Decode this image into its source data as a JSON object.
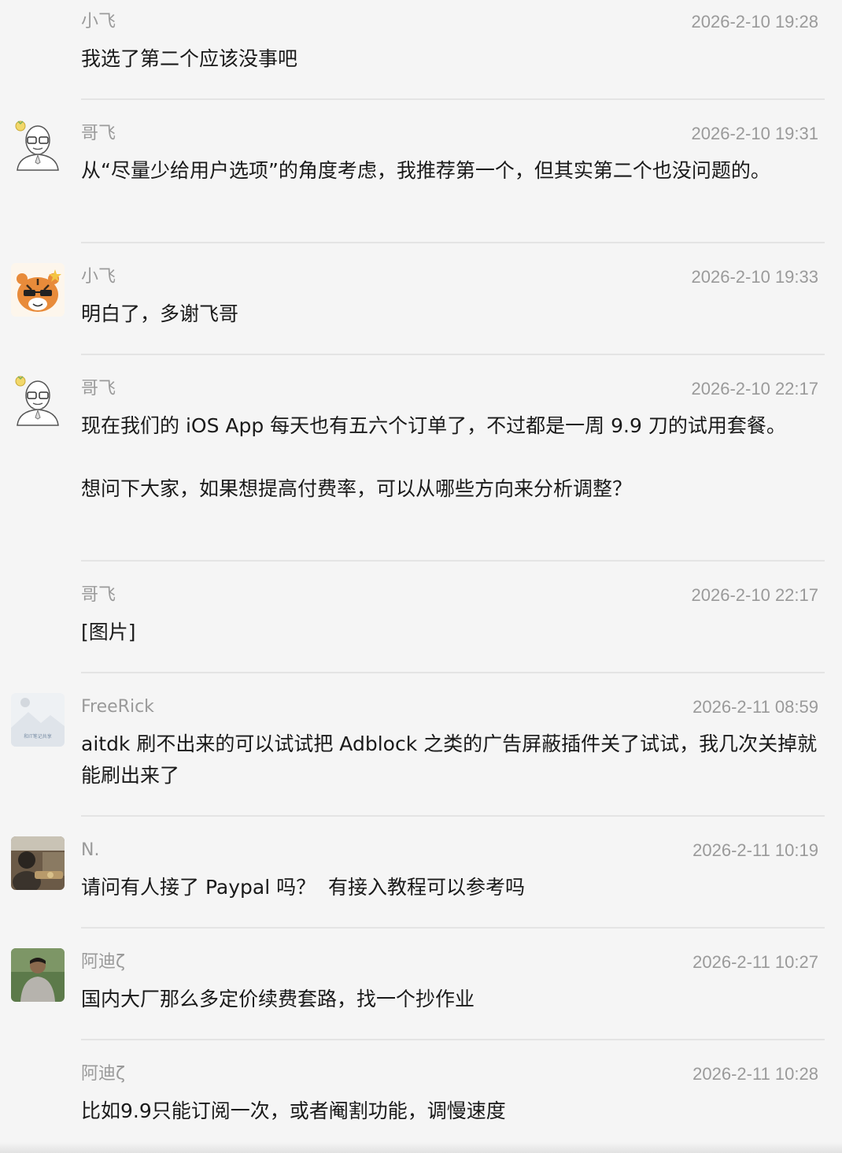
{
  "messages": [
    {
      "sender": "小飞",
      "time": "2026-2-10 19:28",
      "text": "我选了第二个应该没事吧",
      "avatar": "tiger-avatar-icon",
      "show_avatar": false
    },
    {
      "sender": "哥飞",
      "time": "2026-2-10 19:31",
      "text": "从“尽量少给用户选项”的角度考虑，我推荐第一个，但其实第二个也没问题的。",
      "avatar": "bald-man-glasses-avatar-icon",
      "show_avatar": true
    },
    {
      "sender": "小飞",
      "time": "2026-2-10 19:33",
      "text": "明白了，多谢飞哥",
      "avatar": "tiger-avatar-icon",
      "show_avatar": true
    },
    {
      "sender": "哥飞",
      "time": "2026-2-10 22:17",
      "text": "现在我们的 iOS App 每天也有五六个订单了，不过都是一周 9.9 刀的试用套餐。\n\n想问下大家，如果想提高付费率，可以从哪些方向来分析调整？",
      "avatar": "bald-man-glasses-avatar-icon",
      "show_avatar": true
    },
    {
      "sender": "哥飞",
      "time": "2026-2-10 22:17",
      "text": "[图片]",
      "avatar": "bald-man-glasses-avatar-icon",
      "show_avatar": false
    },
    {
      "sender": "FreeRick",
      "time": "2026-2-11 08:59",
      "text": "aitdk 刷不出来的可以试试把 Adblock 之类的广告屏蔽插件关了试试，我几次关掉就能刷出来了",
      "avatar": "landscape-placeholder-avatar-icon",
      "show_avatar": true,
      "avatar_caption": "和IT笔记共享"
    },
    {
      "sender": "N.",
      "time": "2026-2-11 10:19",
      "text": "请问有人接了 Paypal 吗？  有接入教程可以参考吗",
      "avatar": "photo-avatar-icon",
      "show_avatar": true
    },
    {
      "sender": "阿迪ζ",
      "time": "2026-2-11 10:27",
      "text": "国内大厂那么多定价续费套路，找一个抄作业",
      "avatar": "person-photo-avatar-icon",
      "show_avatar": true
    },
    {
      "sender": "阿迪ζ",
      "time": "2026-2-11 10:28",
      "text": "比如9.9只能订阅一次，或者阉割功能，调慢速度",
      "avatar": "person-photo-avatar-icon",
      "show_avatar": false
    }
  ]
}
